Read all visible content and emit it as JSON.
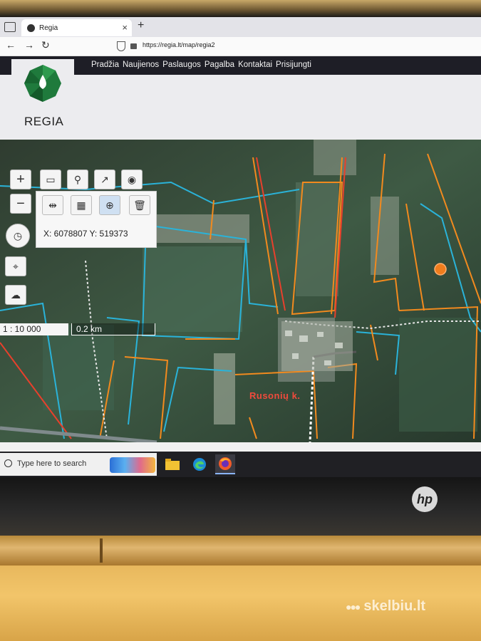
{
  "browser": {
    "tab_title": "Regia",
    "url": "https://regia.lt/map/regia2"
  },
  "site": {
    "logo_text": "REGIA",
    "nav": [
      "Pradžia",
      "Naujienos",
      "Paslaugos",
      "Pagalba",
      "Kontaktai",
      "Prisijungti"
    ]
  },
  "map": {
    "coordinates": "X: 6078807 Y: 519373",
    "place_label": "Rusonių k.",
    "scale_ratio": "1 : 10 000",
    "scale_distance": "0.2 km"
  },
  "taskbar": {
    "search_placeholder": "Type here to search",
    "apps": [
      "file-explorer-icon",
      "edge-icon",
      "firefox-icon"
    ]
  },
  "device": {
    "brand": "hp"
  },
  "watermark": "skelbiu.lt",
  "colors": {
    "parcel_orange": "#f28a1e",
    "parcel_cyan": "#2ab3d9",
    "site_nav_bg": "#1e1e26",
    "logo_green": "#1f7a3c"
  }
}
